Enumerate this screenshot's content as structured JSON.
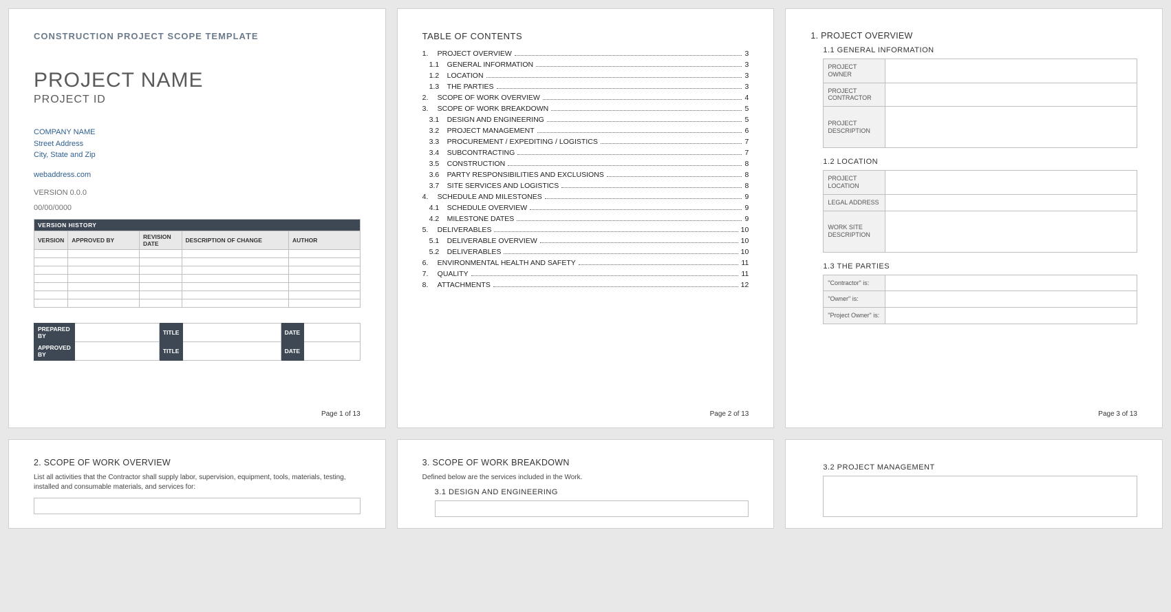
{
  "page1": {
    "template_header": "CONSTRUCTION PROJECT SCOPE TEMPLATE",
    "project_name": "PROJECT NAME",
    "project_id": "PROJECT ID",
    "company_name": "COMPANY NAME",
    "street": "Street Address",
    "city": "City, State and Zip",
    "web": "webaddress.com",
    "version": "VERSION 0.0.0",
    "date": "00/00/0000",
    "version_history_header": "VERSION HISTORY",
    "vh_cols": {
      "c0": "VERSION",
      "c1": "APPROVED BY",
      "c2": "REVISION DATE",
      "c3": "DESCRIPTION OF CHANGE",
      "c4": "AUTHOR"
    },
    "approvals": {
      "prepared": "PREPARED BY",
      "approved": "APPROVED BY",
      "title": "TITLE",
      "date": "DATE"
    },
    "footer": "Page 1 of 13"
  },
  "page2": {
    "title": "TABLE OF CONTENTS",
    "items": [
      {
        "n": "1.",
        "t": "PROJECT OVERVIEW",
        "p": "3",
        "sub": false
      },
      {
        "n": "1.1",
        "t": "GENERAL INFORMATION",
        "p": "3",
        "sub": true
      },
      {
        "n": "1.2",
        "t": "LOCATION",
        "p": "3",
        "sub": true
      },
      {
        "n": "1.3",
        "t": "THE PARTIES",
        "p": "3",
        "sub": true
      },
      {
        "n": "2.",
        "t": "SCOPE OF WORK OVERVIEW",
        "p": "4",
        "sub": false
      },
      {
        "n": "3.",
        "t": "SCOPE OF WORK BREAKDOWN",
        "p": "5",
        "sub": false
      },
      {
        "n": "3.1",
        "t": "DESIGN AND ENGINEERING",
        "p": "5",
        "sub": true
      },
      {
        "n": "3.2",
        "t": "PROJECT MANAGEMENT",
        "p": "6",
        "sub": true
      },
      {
        "n": "3.3",
        "t": "PROCUREMENT / EXPEDITING / LOGISTICS",
        "p": "7",
        "sub": true
      },
      {
        "n": "3.4",
        "t": "SUBCONTRACTING",
        "p": "7",
        "sub": true
      },
      {
        "n": "3.5",
        "t": "CONSTRUCTION",
        "p": "8",
        "sub": true
      },
      {
        "n": "3.6",
        "t": "PARTY RESPONSIBILITIES AND EXCLUSIONS",
        "p": "8",
        "sub": true
      },
      {
        "n": "3.7",
        "t": "SITE SERVICES AND LOGISTICS",
        "p": "8",
        "sub": true
      },
      {
        "n": "4.",
        "t": "SCHEDULE AND MILESTONES",
        "p": "9",
        "sub": false
      },
      {
        "n": "4.1",
        "t": "SCHEDULE OVERVIEW",
        "p": "9",
        "sub": true
      },
      {
        "n": "4.2",
        "t": "MILESTONE DATES",
        "p": "9",
        "sub": true
      },
      {
        "n": "5.",
        "t": "DELIVERABLES",
        "p": "10",
        "sub": false
      },
      {
        "n": "5.1",
        "t": "DELIVERABLE OVERVIEW",
        "p": "10",
        "sub": true
      },
      {
        "n": "5.2",
        "t": "DELIVERABLES",
        "p": "10",
        "sub": true
      },
      {
        "n": "6.",
        "t": "ENVIRONMENTAL HEALTH AND SAFETY",
        "p": "11",
        "sub": false
      },
      {
        "n": "7.",
        "t": "QUALITY",
        "p": "11",
        "sub": false
      },
      {
        "n": "8.",
        "t": "ATTACHMENTS",
        "p": "12",
        "sub": false
      }
    ],
    "footer": "Page 2 of 13"
  },
  "page3": {
    "h1": "1.  PROJECT OVERVIEW",
    "s11": "1.1     GENERAL INFORMATION",
    "owner": "PROJECT OWNER",
    "contractor": "PROJECT CONTRACTOR",
    "desc": "PROJECT DESCRIPTION",
    "s12": "1.2     LOCATION",
    "loc": "PROJECT LOCATION",
    "legal": "LEGAL ADDRESS",
    "site": "WORK SITE DESCRIPTION",
    "s13": "1.3     THE PARTIES",
    "party1": "\"Contractor\" is:",
    "party2": "\"Owner\" is:",
    "party3": "\"Project Owner\" is:",
    "footer": "Page 3 of 13"
  },
  "page4": {
    "h": "2.  SCOPE OF WORK OVERVIEW",
    "body": "List all activities that the Contractor shall supply labor, supervision, equipment, tools, materials, testing, installed and consumable materials, and services for:"
  },
  "page5": {
    "h": "3.  SCOPE OF WORK BREAKDOWN",
    "body": "Defined below are the services included in the Work.",
    "s31": "3.1     DESIGN AND ENGINEERING"
  },
  "page6": {
    "s32": "3.2     PROJECT MANAGEMENT"
  }
}
